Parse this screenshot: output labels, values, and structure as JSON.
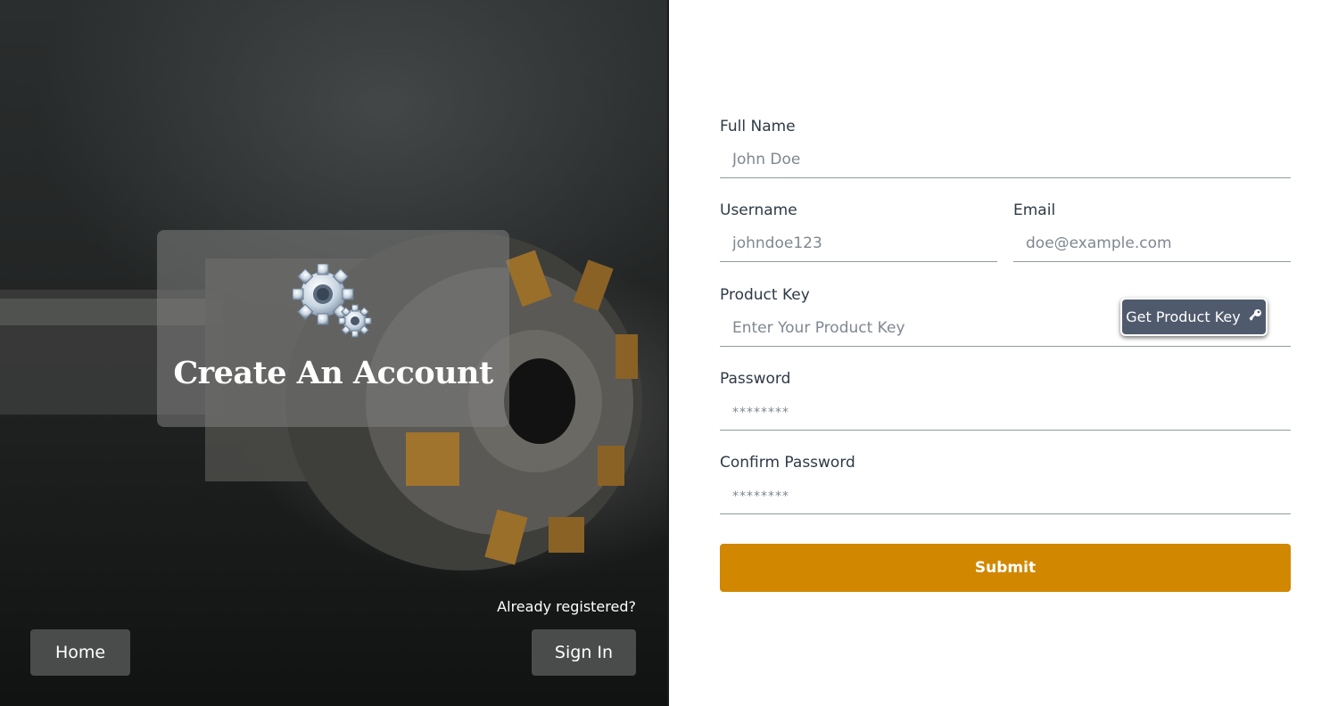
{
  "hero": {
    "title": "Create An Account",
    "gear_icon": "gears-icon",
    "already_registered": "Already registered?",
    "home_label": "Home",
    "signin_label": "Sign In"
  },
  "form": {
    "full_name": {
      "label": "Full Name",
      "placeholder": "John Doe"
    },
    "username": {
      "label": "Username",
      "placeholder": "johndoe123"
    },
    "email": {
      "label": "Email",
      "placeholder": "doe@example.com"
    },
    "product_key": {
      "label": "Product Key",
      "placeholder": "Enter Your Product Key",
      "button_label": "Get Product Key",
      "button_icon": "key-icon"
    },
    "password": {
      "label": "Password",
      "placeholder": "********"
    },
    "confirm_password": {
      "label": "Confirm Password",
      "placeholder": "********"
    },
    "submit_label": "Submit"
  },
  "colors": {
    "accent": "#d18800",
    "product_key_button": "#4f5a6c",
    "text": "#2e3a45"
  }
}
